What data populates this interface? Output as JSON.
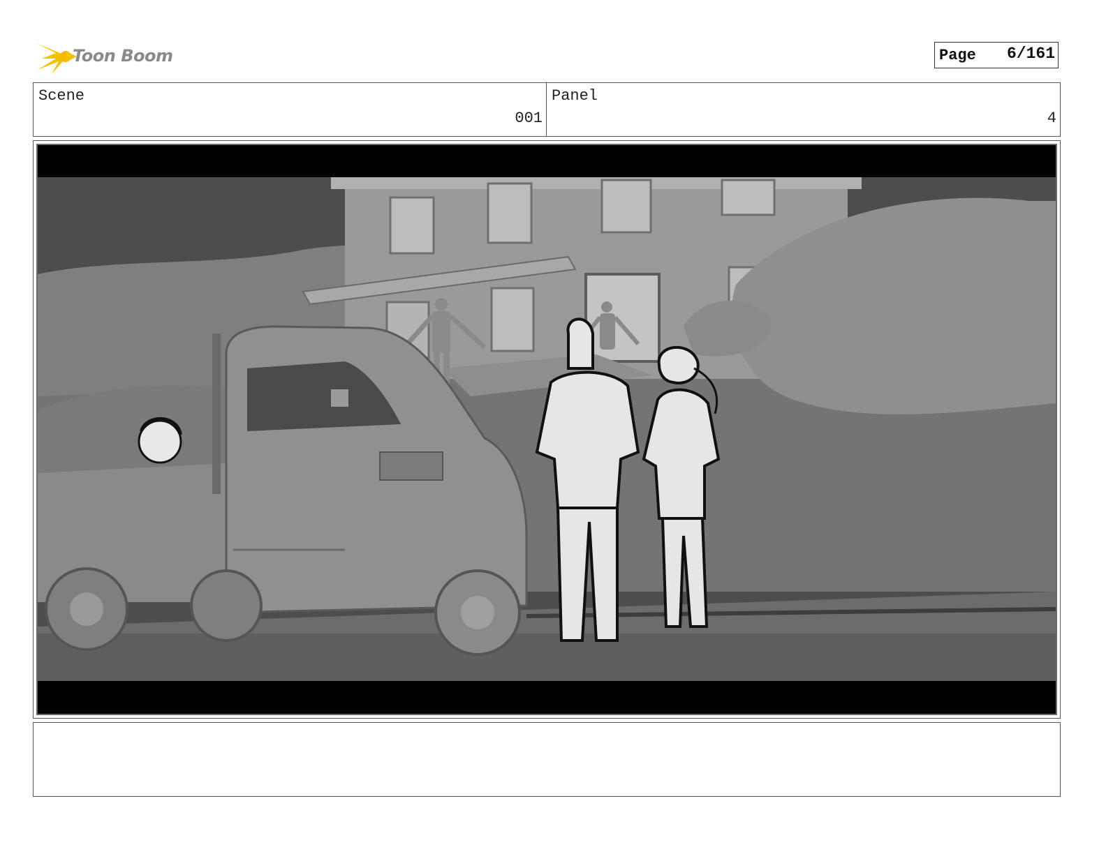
{
  "header": {
    "logo_text": "Toon Boom",
    "page_label": "Page",
    "page_value": "6/161"
  },
  "info": {
    "scene_label": "Scene",
    "scene_value": "001",
    "panel_label": "Panel",
    "panel_value": "4"
  },
  "notes": {
    "text": ""
  },
  "colors": {
    "logo_yellow": "#f5c200",
    "letterbox": "#000000",
    "scene_gray": "#8c8c8c"
  }
}
